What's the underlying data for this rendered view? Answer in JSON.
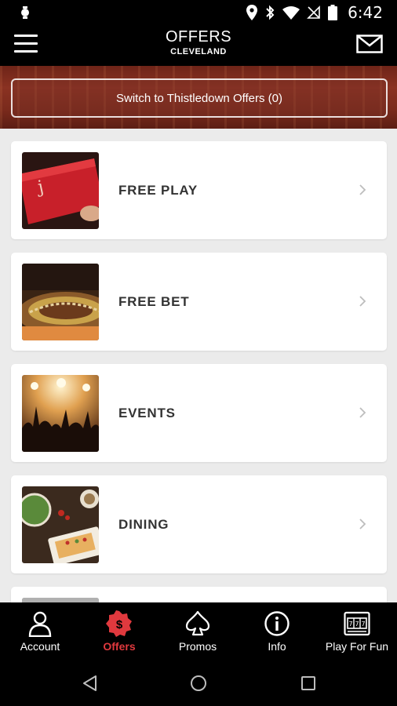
{
  "status_bar": {
    "time": "6:42",
    "icons": [
      "location-icon",
      "bluetooth-icon",
      "wifi-icon",
      "no-sim-icon",
      "battery-icon"
    ]
  },
  "header": {
    "title": "OFFERS",
    "subtitle": "CLEVELAND",
    "menu_icon": "hamburger-icon",
    "mail_icon": "mail-icon"
  },
  "banner": {
    "switch_label": "Switch to Thistledown Offers (0)"
  },
  "offers": [
    {
      "label": "FREE PLAY",
      "image": "red-players-card-photo"
    },
    {
      "label": "FREE BET",
      "image": "roulette-wheel-photo"
    },
    {
      "label": "EVENTS",
      "image": "concert-crowd-photo"
    },
    {
      "label": "DINING",
      "image": "dining-table-photo"
    },
    {
      "label": "",
      "image": "partial-card-photo"
    }
  ],
  "tabs": [
    {
      "label": "Account",
      "icon": "person-icon",
      "active": false
    },
    {
      "label": "Offers",
      "icon": "dollar-badge-icon",
      "active": true
    },
    {
      "label": "Promos",
      "icon": "spade-icon",
      "active": false
    },
    {
      "label": "Info",
      "icon": "info-icon",
      "active": false
    },
    {
      "label": "Play For Fun",
      "icon": "slot-machine-icon",
      "active": false
    }
  ],
  "colors": {
    "accent": "#e0393e",
    "banner": "#7a2a1c",
    "background": "#ebebeb"
  }
}
